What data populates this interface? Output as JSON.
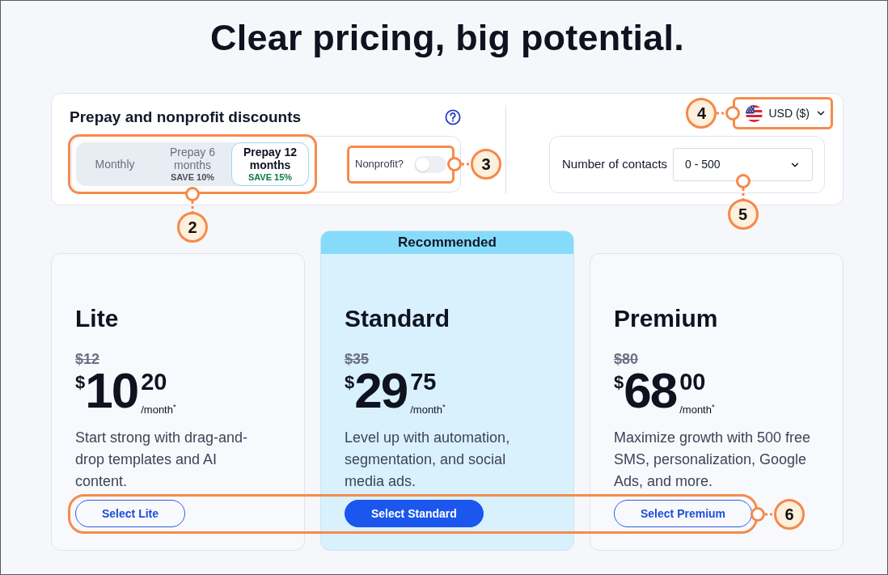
{
  "title": "Clear pricing, big potential.",
  "discounts": {
    "heading": "Prepay and nonprofit discounts",
    "billing_options": [
      {
        "label": "Monthly",
        "selected": false
      },
      {
        "label": "Prepay 6 months",
        "note": "SAVE 10%",
        "selected": false
      },
      {
        "label": "Prepay 12 months",
        "note": "SAVE 15%",
        "selected": true
      }
    ],
    "billing_callout": "2",
    "nonprofit": {
      "label": "Nonprofit?",
      "on": false,
      "callout": "3"
    }
  },
  "currency": {
    "value": "USD ($)",
    "callout": "4"
  },
  "contacts": {
    "label": "Number of contacts",
    "value": "0 - 500",
    "callout": "5"
  },
  "plans": [
    {
      "name": "Lite",
      "old_price": "$12",
      "currency": "$",
      "whole": "10",
      "cents": "20",
      "period": "/month$^{*}$",
      "description": "Start strong with drag-and-drop templates and AI content.",
      "button": {
        "label": "Select Lite",
        "kind": "outline"
      }
    },
    {
      "badge": "Recommended",
      "name": "Standard",
      "old_price": "$35",
      "currency": "$",
      "whole": "29",
      "cents": "75",
      "period": "/month$^{*}$",
      "description": "Level up with automation, segmentation, and social media ads.",
      "button": {
        "label": "Select Standard",
        "kind": "filled"
      }
    },
    {
      "name": "Premium",
      "old_price": "$80",
      "currency": "$",
      "whole": "68",
      "cents": "00",
      "period": "/month$^{*}$",
      "description": "Maximize growth with 500 free SMS, personalization, Google Ads, and more.",
      "button": {
        "label": "Select Premium",
        "kind": "outline"
      }
    }
  ],
  "plans_callout": "6"
}
